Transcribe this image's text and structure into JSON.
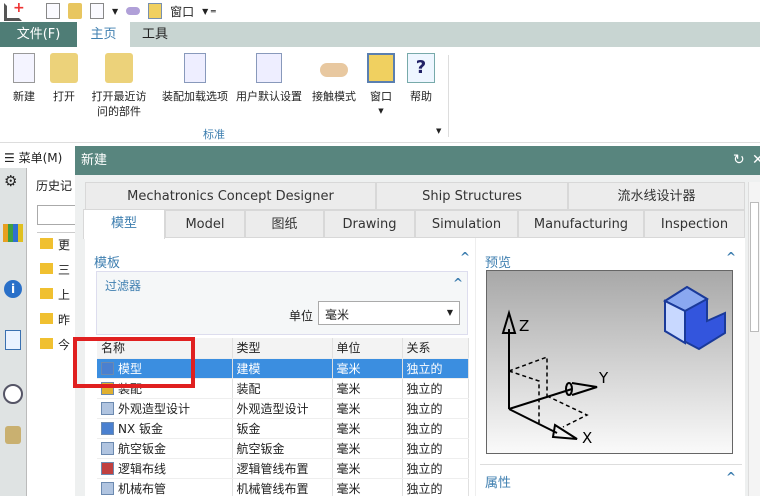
{
  "quick_bar": {
    "window_label": "窗口"
  },
  "ribbon_tabs": [
    "文件(F)",
    "主页",
    "工具"
  ],
  "ribbon": {
    "buttons": [
      "新建",
      "打开",
      "打开最近访\n问的部件",
      "装配加载选项",
      "用户默认设置",
      "接触模式",
      "窗口",
      "帮助"
    ],
    "group_label": "标准"
  },
  "menu_label": "菜单(M)",
  "history": {
    "title": "历史记",
    "items": [
      "更",
      "三",
      "上",
      "昨",
      "今"
    ]
  },
  "dialog": {
    "title": "新建",
    "tabs_row1": [
      "Mechatronics Concept Designer",
      "Ship Structures",
      "流水线设计器"
    ],
    "tabs_row2": [
      "模型",
      "Model",
      "图纸",
      "Drawing",
      "Simulation",
      "Manufacturing",
      "Inspection"
    ],
    "template_section": "模板",
    "filter_section": "过滤器",
    "unit_label": "单位",
    "unit_value": "毫米",
    "columns": [
      "名称",
      "类型",
      "单位",
      "关系"
    ],
    "rows": [
      [
        "模型",
        "建模",
        "毫米",
        "独立的"
      ],
      [
        "装配",
        "装配",
        "毫米",
        "独立的"
      ],
      [
        "外观造型设计",
        "外观造型设计",
        "毫米",
        "独立的"
      ],
      [
        "NX 钣金",
        "钣金",
        "毫米",
        "独立的"
      ],
      [
        "航空钣金",
        "航空钣金",
        "毫米",
        "独立的"
      ],
      [
        "逻辑布线",
        "逻辑管线布置",
        "毫米",
        "独立的"
      ],
      [
        "机械布管",
        "机械管线布置",
        "毫米",
        "独立的"
      ]
    ],
    "preview_section": "预览",
    "axis_labels": [
      "Z",
      "Y",
      "X"
    ],
    "properties_section": "属性"
  }
}
